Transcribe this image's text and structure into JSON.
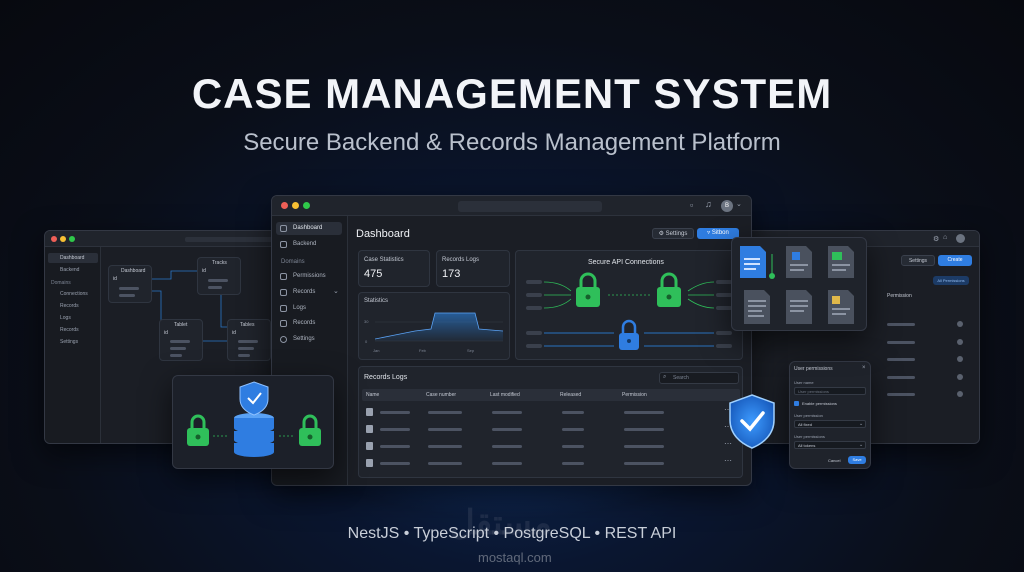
{
  "hero": {
    "title": "CASE MANAGEMENT SYSTEM",
    "subtitle": "Secure Backend & Records Management Platform",
    "stack": "NestJS • TypeScript • PostgreSQL • REST API",
    "watermark": "مستقل",
    "watermark_url": "mostaql.com"
  },
  "main_window": {
    "avatar": "B",
    "sidebar": [
      {
        "label": "Dashboard",
        "active": true
      },
      {
        "label": "Backend",
        "active": false
      },
      {
        "label": "Domains",
        "active": false,
        "section": true
      },
      {
        "label": "Permissions",
        "active": false
      },
      {
        "label": "Records",
        "active": false
      },
      {
        "label": "Logs",
        "active": false
      },
      {
        "label": "Records",
        "active": false
      },
      {
        "label": "Settings",
        "active": false
      }
    ],
    "heading": "Dashboard",
    "settings_button": "Settings",
    "filter_button": "Sitbon",
    "stats": [
      {
        "label": "Case Statistics",
        "value": "475"
      },
      {
        "label": "Records Logs",
        "value": "173"
      }
    ],
    "statistics_title": "Statistics",
    "statistics_axis": [
      "30",
      "0"
    ],
    "statistics_months": [
      "Jan",
      "Feb",
      "Sep"
    ],
    "api_title": "Secure API Connections",
    "records_title": "Records Logs",
    "search_placeholder": "Search",
    "columns": [
      "Name",
      "Case number",
      "Last modified",
      "Released",
      "Permission"
    ],
    "row_count": 4
  },
  "left_window": {
    "sidebar": [
      "Dashboard",
      "Backend",
      "Domains",
      "Connections",
      "Records",
      "Logs",
      "Records",
      "Settings"
    ],
    "tables": [
      "Dashboard",
      "Tracks",
      "Tablet",
      "Tables"
    ],
    "field": "id"
  },
  "right_window": {
    "settings_button": "Settings",
    "create_button": "Create",
    "all_permissions": "All Permissions",
    "column": "Permission",
    "modal": {
      "title": "User permissions",
      "field1_label": "User name",
      "field1_placeholder": "User permissions",
      "checkbox_label": "Enable permissions",
      "field2_label": "User permission",
      "field2_value": "All fixed",
      "field3_label": "User permissions",
      "field3_value": "All tokens",
      "cancel": "Cancel",
      "save": "Save"
    }
  },
  "colors": {
    "accent": "#2f7de1",
    "lock_green": "#2fbf5a",
    "lock_blue": "#2f7de1",
    "shield": "#2d8cf0"
  }
}
